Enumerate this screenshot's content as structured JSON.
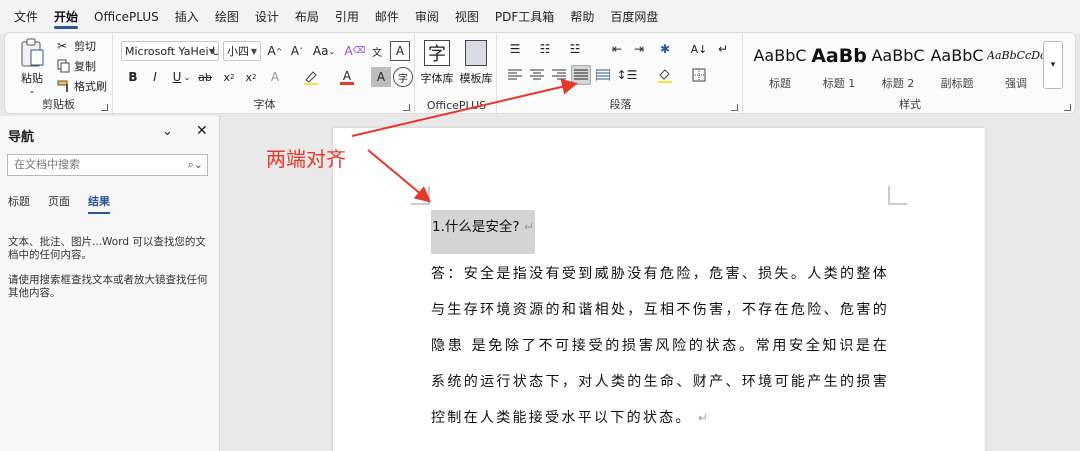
{
  "menu": {
    "tabs": [
      "文件",
      "开始",
      "OfficePLUS",
      "插入",
      "绘图",
      "设计",
      "布局",
      "引用",
      "邮件",
      "审阅",
      "视图",
      "PDF工具箱",
      "帮助",
      "百度网盘"
    ],
    "active": "开始"
  },
  "clipboard": {
    "paste": "粘贴",
    "cut": "剪切",
    "copy": "复制",
    "format_painter": "格式刷",
    "label": "剪贴板"
  },
  "font": {
    "name": "Microsoft YaHei UI",
    "size": "小四",
    "label": "字体",
    "grow": "A^",
    "shrink": "Aˇ",
    "case": "Aa"
  },
  "officeplus": {
    "font_lib": "字体库",
    "template_lib": "模板库",
    "label": "OfficePLUS"
  },
  "paragraph": {
    "label": "段落",
    "active_button": "justify"
  },
  "styles": {
    "label": "样式",
    "items": [
      {
        "sample": "AaBbC",
        "name": "标题"
      },
      {
        "sample": "AaBb",
        "name": "标题 1"
      },
      {
        "sample": "AaBbC",
        "name": "标题 2"
      },
      {
        "sample": "AaBbC",
        "name": "副标题"
      },
      {
        "sample": "AaBbCcDc",
        "name": "强调"
      }
    ]
  },
  "nav": {
    "title": "导航",
    "search_placeholder": "在文档中搜索",
    "tabs": [
      "标题",
      "页面",
      "结果"
    ],
    "active_tab": "结果",
    "hint1": "文本、批注、图片...Word 可以查找您的文档中的任何内容。",
    "hint2": "请使用搜索框查找文本或者放大镜查找任何其他内容。"
  },
  "annotation": "两端对齐",
  "doc": {
    "heading": "1.什么是安全?",
    "body": "答：安全是指没有受到威胁没有危险，危害、损失。人类的整体与生存环境资源的和谐相处，互相不伤害，不存在危险、危害的隐患 是免除了不可接受的损害风险的状态。常用安全知识是在系统的运行状态下，对人类的生命、财产、环境可能产生的损害控制在人类能接受水平以下的状态。"
  },
  "colors": {
    "accent": "#2b579a",
    "annotation": "#e8372b",
    "font_color": "#e8372b"
  }
}
